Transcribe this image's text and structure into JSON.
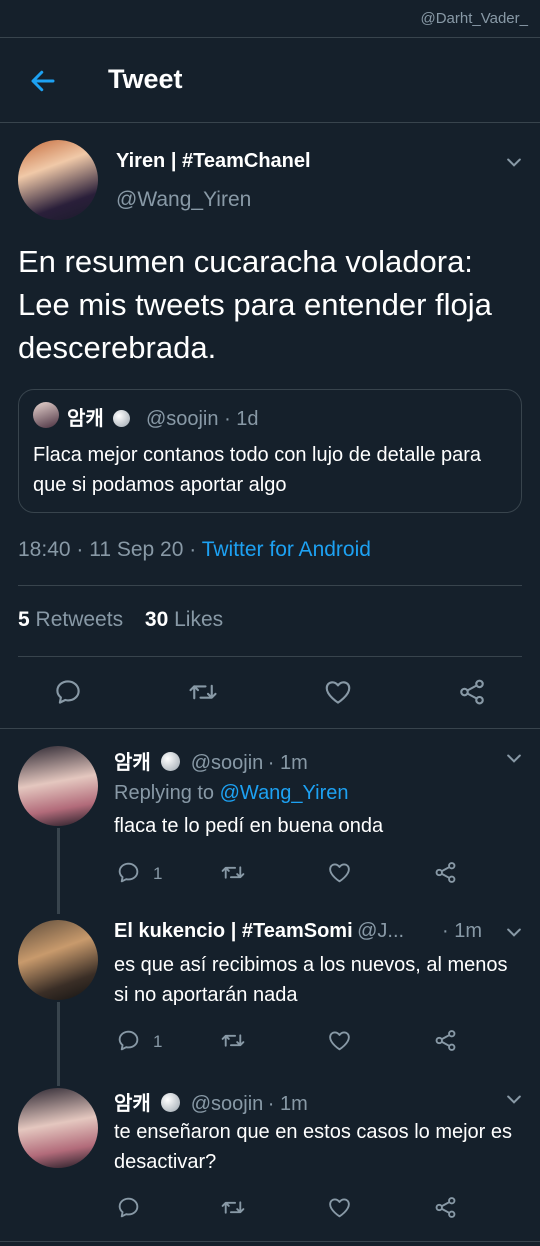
{
  "watermark": "@Darht_Vader_",
  "header": {
    "title": "Tweet"
  },
  "main_tweet": {
    "name": "Yiren | #TeamChanel",
    "handle": "@Wang_Yiren",
    "text": "En resumen cucaracha voladora: Lee mis tweets para entender floja descerebrada.",
    "quote": {
      "name": "암캐",
      "handle": "@soojin",
      "time": "· 1d",
      "text": "Flaca mejor contanos todo con lujo de detalle para que si podamos aportar algo"
    },
    "time": "18:40 · 11 Sep 20 ·",
    "source": "Twitter for Android",
    "retweets": "5",
    "retweets_label": "Retweets",
    "likes": "30",
    "likes_label": "Likes"
  },
  "replies": [
    {
      "name": "암캐",
      "handle": "@soojin",
      "time": "· 1m",
      "replying_prefix": "Replying to",
      "replying_to": "@Wang_Yiren",
      "text": "flaca te lo pedí en buena onda",
      "reply_count": "1"
    },
    {
      "name": "El kukencio | #TeamSomi",
      "handle": "@J...",
      "time": "· 1m",
      "text": "es que así recibimos a los nuevos, al menos si no aportarán nada",
      "reply_count": "1"
    },
    {
      "name": "암캐",
      "handle": "@soojin",
      "time": "· 1m",
      "text": "te enseñaron que en estos casos lo mejor es desactivar?",
      "reply_count": ""
    }
  ],
  "colors": {
    "background": "#15202b",
    "accent": "#1da1f2",
    "muted": "#8899a6",
    "divider": "#38444d"
  }
}
